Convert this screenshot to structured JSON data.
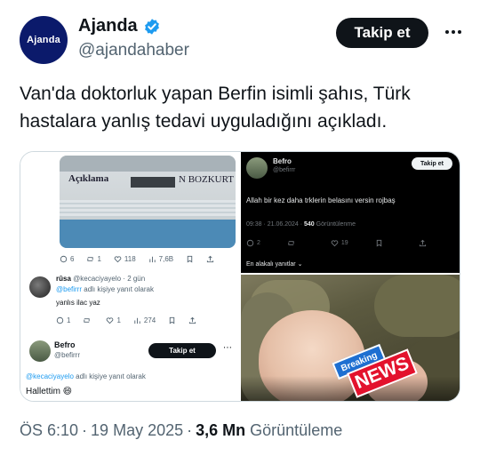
{
  "post": {
    "author_name": "Ajanda",
    "author_handle": "@ajandahaber",
    "avatar_text": "Ajanda",
    "follow_label": "Takip et",
    "text": "Van'da doktorluk yapan Berfin isimli şahıs, Türk hastalara yanlış tedavi uyguladığını açıkladı.",
    "time": "ÖS 6:10",
    "date": "19 May 2025",
    "views_count": "3,6 Mn",
    "views_label": "Görüntüleme",
    "verified_color": "#1d9bf0"
  },
  "left_shot": {
    "doc_title": "Açıklama",
    "doc_name": "N BOZKURT",
    "stats": {
      "replies": "6",
      "reposts": "1",
      "likes": "118",
      "views": "7,6B"
    },
    "reply": {
      "name": "rûsa",
      "handle": "@kecaciyayelo",
      "time": "2 gün",
      "replying_prefix": "@befirrr",
      "replying_suffix": "adlı kişiye yanıt olarak",
      "text": "yanlıs ilac yaz",
      "stats": {
        "replies": "1",
        "reposts": "",
        "likes": "1",
        "views": "274"
      }
    },
    "befro": {
      "name": "Befro",
      "handle": "@befirrr",
      "follow_label": "Takip et",
      "replying_prefix": "@kecaciyayelo",
      "replying_suffix": "adlı kişiye yanıt olarak",
      "text": "Hallettim 😄"
    }
  },
  "dark_shot": {
    "name": "Befro",
    "handle": "@befirrr",
    "follow_label": "Takip et",
    "text": "Allah bir kez daha trklerin belasını versin rojbaş",
    "timestamp": "09:38 · 21.06.2024 ·",
    "views_count": "540",
    "views_label": "Görüntülenme",
    "stats": {
      "replies": "2",
      "likes": "19"
    },
    "sort_label": "En alakalı yanıtlar"
  },
  "photo": {
    "badge_top": "Breaking",
    "badge_bottom": "NEWS"
  }
}
